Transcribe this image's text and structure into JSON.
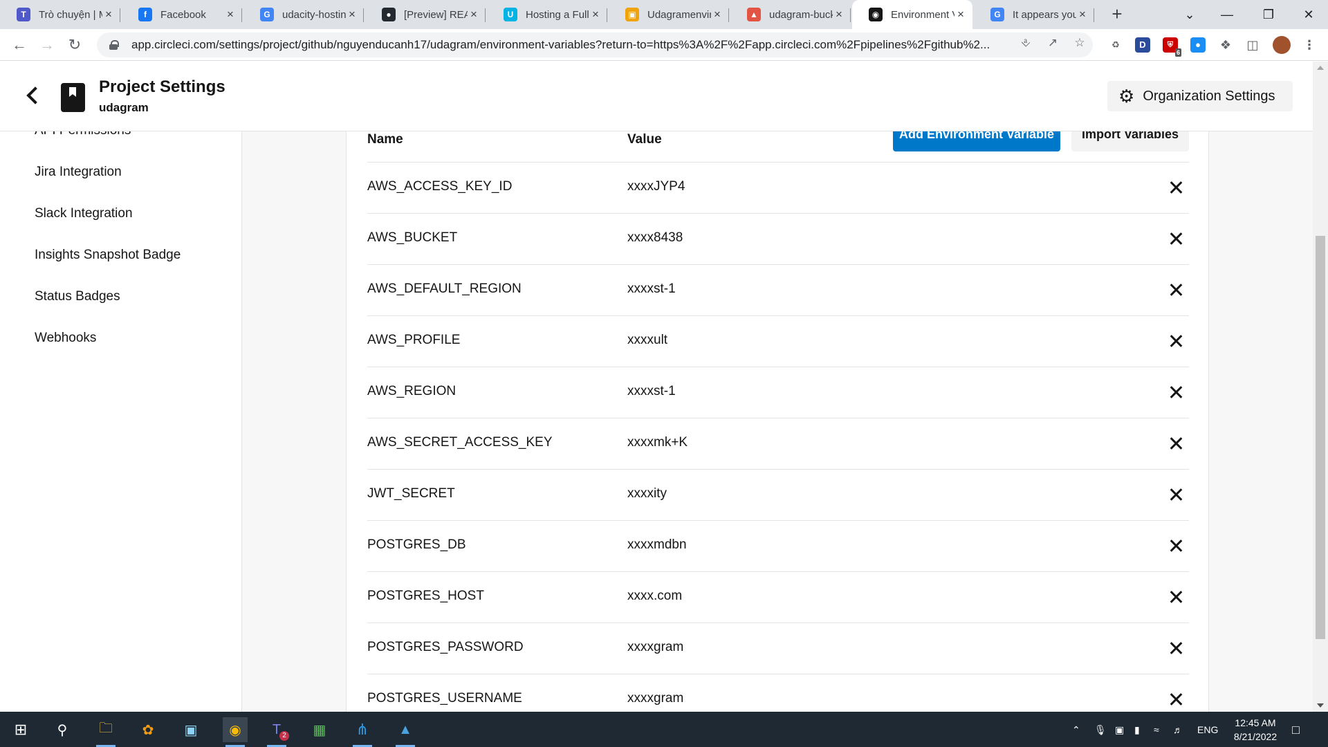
{
  "browser": {
    "tabs": [
      {
        "title": "Trò chuyện | M",
        "icon": "teams-icon",
        "color": "#5059c9",
        "glyph": "T"
      },
      {
        "title": "Facebook",
        "icon": "facebook-icon",
        "color": "#1877f2",
        "glyph": "f"
      },
      {
        "title": "udacity-hostin",
        "icon": "google-icon",
        "color": "#4285f4",
        "glyph": "G"
      },
      {
        "title": "[Preview] REA",
        "icon": "github-icon",
        "color": "#24292f",
        "glyph": "●"
      },
      {
        "title": "Hosting a Full",
        "icon": "udacity-icon",
        "color": "#02b3e4",
        "glyph": "U"
      },
      {
        "title": "Udagramenvir",
        "icon": "aws-beanstalk-icon",
        "color": "#f0a30a",
        "glyph": "▣"
      },
      {
        "title": "udagram-buck",
        "icon": "aws-s3-icon",
        "color": "#e25444",
        "glyph": "▲"
      },
      {
        "title": "Environment V",
        "icon": "circleci-icon",
        "color": "#161616",
        "glyph": "◉",
        "active": true
      },
      {
        "title": "It appears you",
        "icon": "google-icon",
        "color": "#4285f4",
        "glyph": "G"
      }
    ],
    "url": "app.circleci.com/settings/project/github/nguyenducanh17/udagram/environment-variables?return-to=https%3A%2F%2Fapp.circleci.com%2Fpipelines%2Fgithub%2..."
  },
  "header": {
    "title": "Project Settings",
    "project": "udagram",
    "org_settings_label": "Organization Settings"
  },
  "sidebar": {
    "items": [
      {
        "label": "API Permissions"
      },
      {
        "label": "Jira Integration"
      },
      {
        "label": "Slack Integration"
      },
      {
        "label": "Insights Snapshot Badge"
      },
      {
        "label": "Status Badges"
      },
      {
        "label": "Webhooks"
      }
    ]
  },
  "env": {
    "col_name": "Name",
    "col_value": "Value",
    "add_label": "Add Environment Variable",
    "import_label": "Import Variables",
    "rows": [
      {
        "name": "AWS_ACCESS_KEY_ID",
        "value": "xxxxJYP4"
      },
      {
        "name": "AWS_BUCKET",
        "value": "xxxx8438"
      },
      {
        "name": "AWS_DEFAULT_REGION",
        "value": "xxxxst-1"
      },
      {
        "name": "AWS_PROFILE",
        "value": "xxxxult"
      },
      {
        "name": "AWS_REGION",
        "value": "xxxxst-1"
      },
      {
        "name": "AWS_SECRET_ACCESS_KEY",
        "value": "xxxxmk+K"
      },
      {
        "name": "JWT_SECRET",
        "value": "xxxxity"
      },
      {
        "name": "POSTGRES_DB",
        "value": "xxxxmdbn"
      },
      {
        "name": "POSTGRES_HOST",
        "value": "xxxx.com"
      },
      {
        "name": "POSTGRES_PASSWORD",
        "value": "xxxxgram"
      },
      {
        "name": "POSTGRES_USERNAME",
        "value": "xxxxgram"
      }
    ]
  },
  "taskbar": {
    "language": "ENG",
    "time": "12:45 AM",
    "date": "8/21/2022",
    "teams_badge": "2",
    "ext_badge": "6"
  },
  "colors": {
    "primary_button": "#0078ca",
    "taskbar": "#1f2933"
  }
}
